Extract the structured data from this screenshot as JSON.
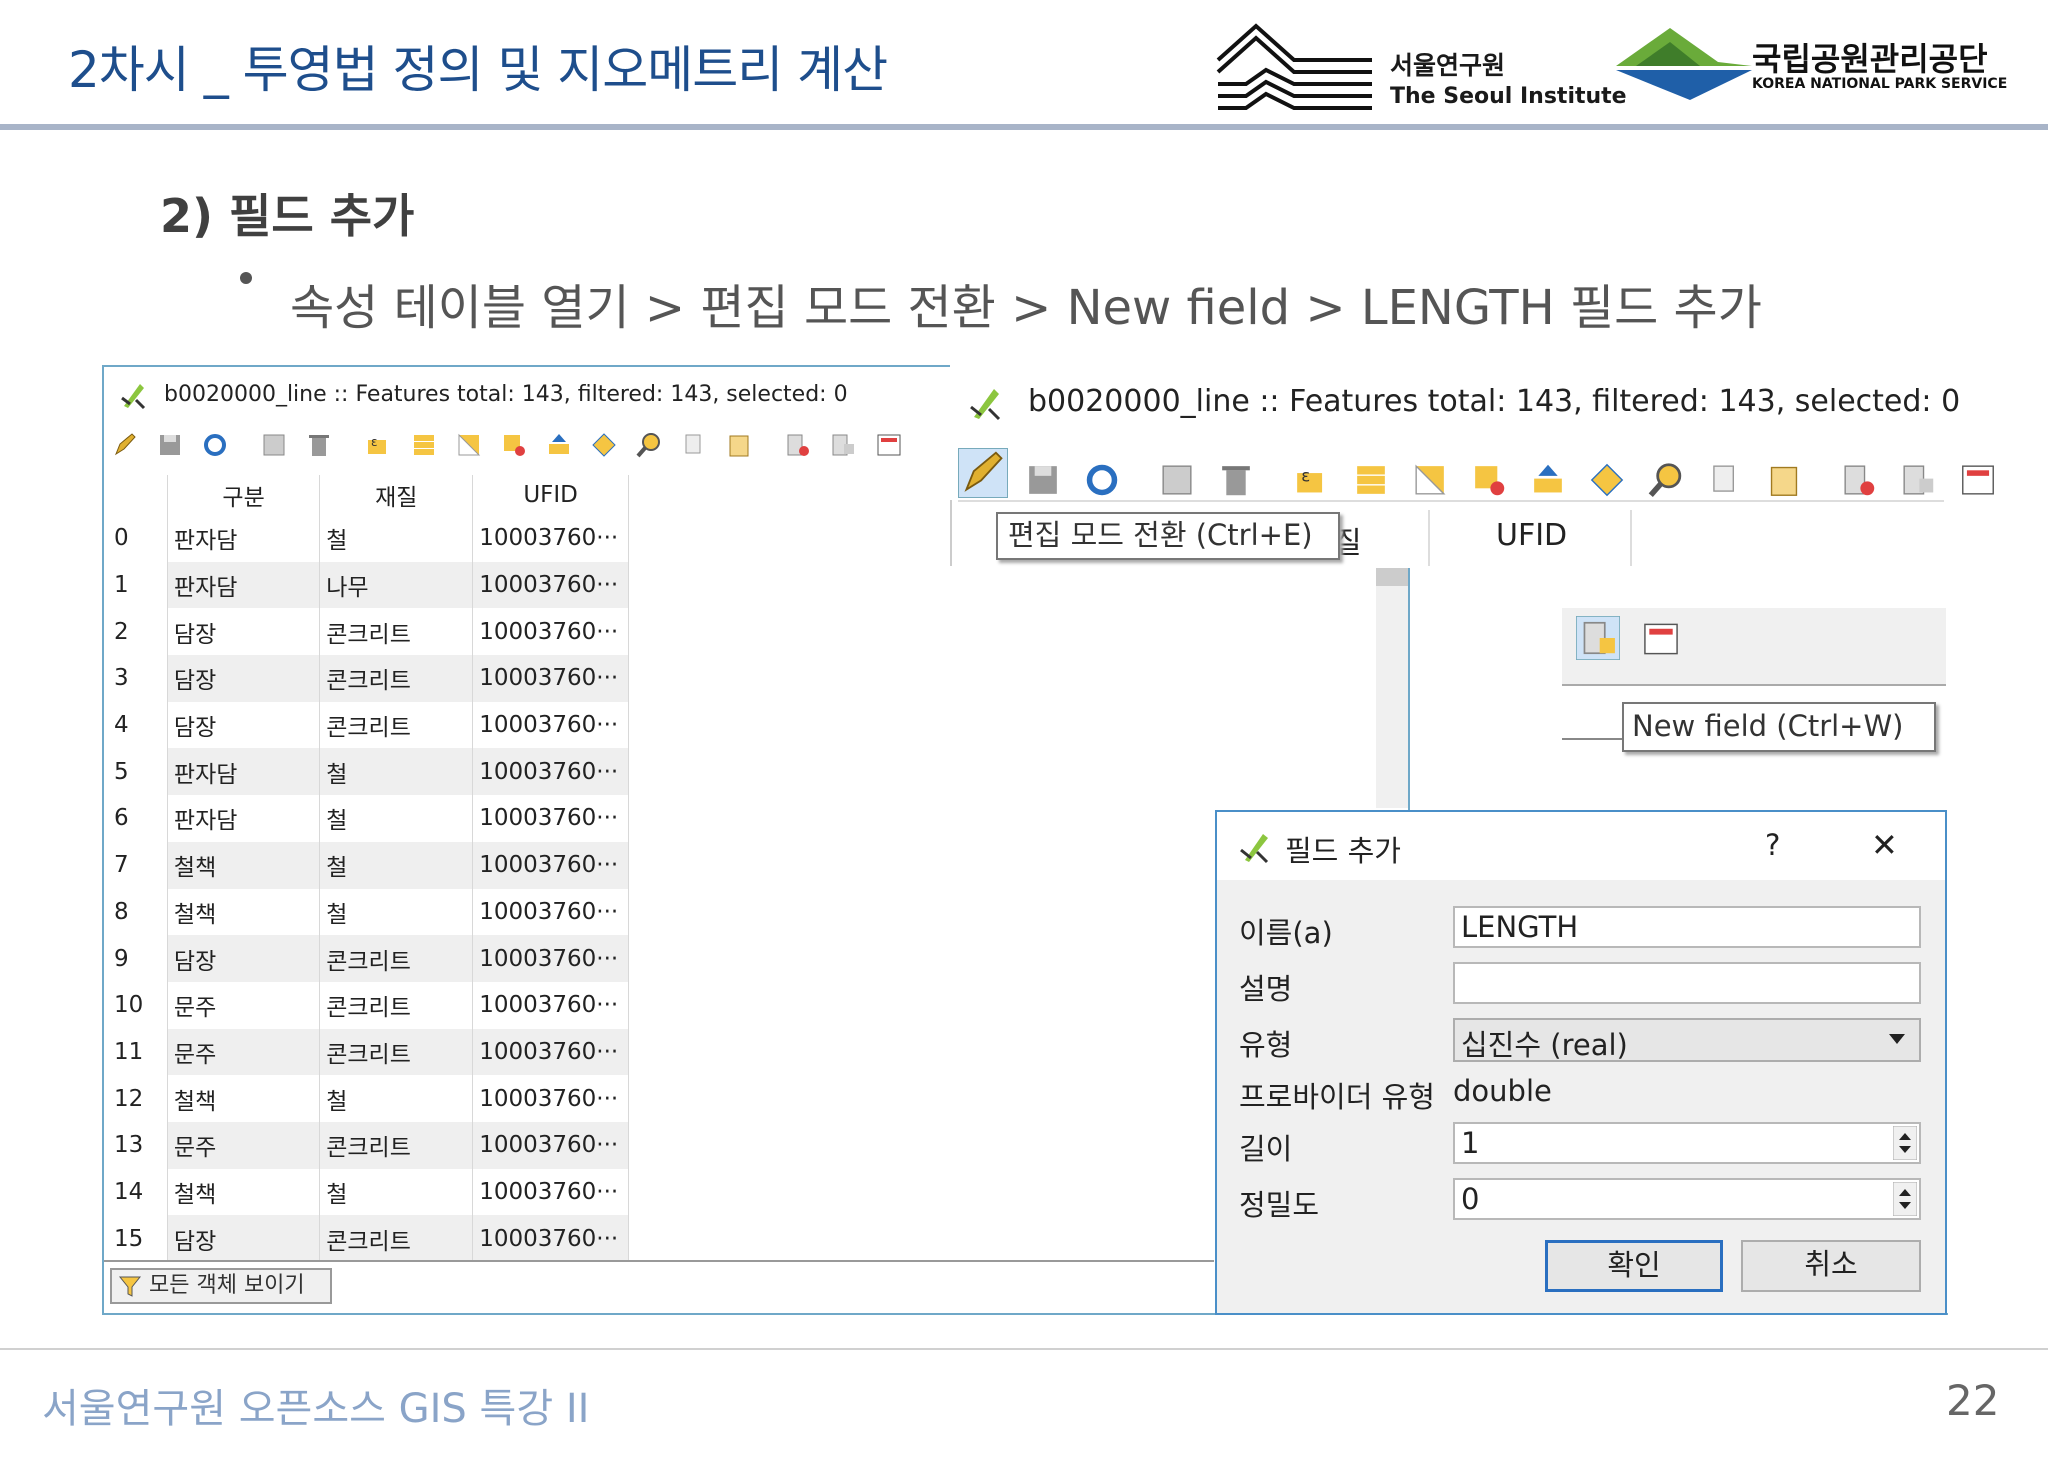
{
  "header": {
    "title": "2차시 _ 투영법 정의 및 지오메트리 계산",
    "seoul_logo_ko": "서울연구원",
    "seoul_logo_en": "The Seoul Institute",
    "knps_logo_ko": "국립공원관리공단",
    "knps_logo_en": "KOREA NATIONAL PARK SERVICE"
  },
  "section": {
    "title": "2) 필드 추가",
    "bullet": "속성 테이블 열기 > 편집 모드 전환 > New field > LENGTH 필드 추가"
  },
  "attr_window": {
    "title": "b0020000_line :: Features total: 143, filtered: 143, selected: 0",
    "columns": [
      "구분",
      "재질",
      "UFID"
    ],
    "rows": [
      {
        "idx": "0",
        "c1": "판자담",
        "c2": "철",
        "c3": "10003760···"
      },
      {
        "idx": "1",
        "c1": "판자담",
        "c2": "나무",
        "c3": "10003760···"
      },
      {
        "idx": "2",
        "c1": "담장",
        "c2": "콘크리트",
        "c3": "10003760···"
      },
      {
        "idx": "3",
        "c1": "담장",
        "c2": "콘크리트",
        "c3": "10003760···"
      },
      {
        "idx": "4",
        "c1": "담장",
        "c2": "콘크리트",
        "c3": "10003760···"
      },
      {
        "idx": "5",
        "c1": "판자담",
        "c2": "철",
        "c3": "10003760···"
      },
      {
        "idx": "6",
        "c1": "판자담",
        "c2": "철",
        "c3": "10003760···"
      },
      {
        "idx": "7",
        "c1": "철책",
        "c2": "철",
        "c3": "10003760···"
      },
      {
        "idx": "8",
        "c1": "철책",
        "c2": "철",
        "c3": "10003760···"
      },
      {
        "idx": "9",
        "c1": "담장",
        "c2": "콘크리트",
        "c3": "10003760···"
      },
      {
        "idx": "10",
        "c1": "문주",
        "c2": "콘크리트",
        "c3": "10003760···"
      },
      {
        "idx": "11",
        "c1": "문주",
        "c2": "콘크리트",
        "c3": "10003760···"
      },
      {
        "idx": "12",
        "c1": "철책",
        "c2": "철",
        "c3": "10003760···"
      },
      {
        "idx": "13",
        "c1": "문주",
        "c2": "콘크리트",
        "c3": "10003760···"
      },
      {
        "idx": "14",
        "c1": "철책",
        "c2": "철",
        "c3": "10003760···"
      },
      {
        "idx": "15",
        "c1": "담장",
        "c2": "콘크리트",
        "c3": "10003760···"
      }
    ],
    "show_all_label": "모든 객체 보이기"
  },
  "zoom_window": {
    "title": "b0020000_line :: Features total: 143, filtered: 143, selected: 0",
    "tooltip_edit": "편집 모드 전환 (Ctrl+E)",
    "col_fragment": "질",
    "col_ufid": "UFID",
    "tooltip_new_field": "New field (Ctrl+W)"
  },
  "dialog": {
    "title": "필드 추가",
    "help": "?",
    "close": "✕",
    "name_label": "이름(a)",
    "name_value": "LENGTH",
    "comment_label": "설명",
    "comment_value": "",
    "type_label": "유형",
    "type_value": "십진수 (real)",
    "provider_label": "프로바이더 유형",
    "provider_value": "double",
    "length_label": "길이",
    "length_value": "1",
    "precision_label": "정밀도",
    "precision_value": "0",
    "ok": "확인",
    "cancel": "취소"
  },
  "footer": {
    "text": "서울연구원 오픈소스 GIS 특강 II",
    "page": "22"
  }
}
